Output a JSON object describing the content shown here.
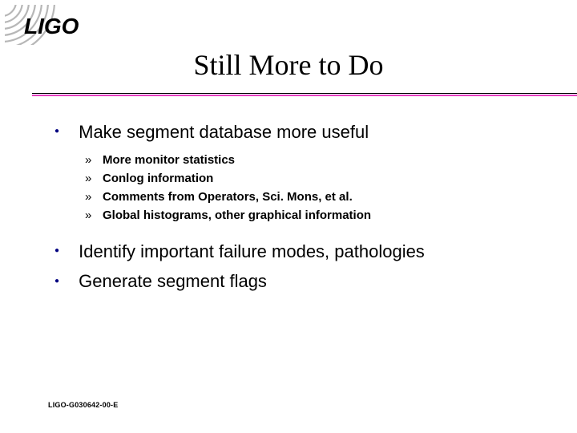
{
  "logo_text": "LIGO",
  "title": "Still More to Do",
  "bullets": {
    "b1": {
      "text": "Make segment database more useful",
      "subs": {
        "s1": "More monitor statistics",
        "s2": "Conlog information",
        "s3": "Comments from Operators, Sci. Mons, et al.",
        "s4": "Global histograms, other graphical information"
      }
    },
    "b2": {
      "text": "Identify important failure modes, pathologies"
    },
    "b3": {
      "text": "Generate segment flags"
    }
  },
  "docnum": "LIGO-G030642-00-E",
  "colors": {
    "bullet_dot": "#000080",
    "rule_accent": "#e63fbf"
  }
}
